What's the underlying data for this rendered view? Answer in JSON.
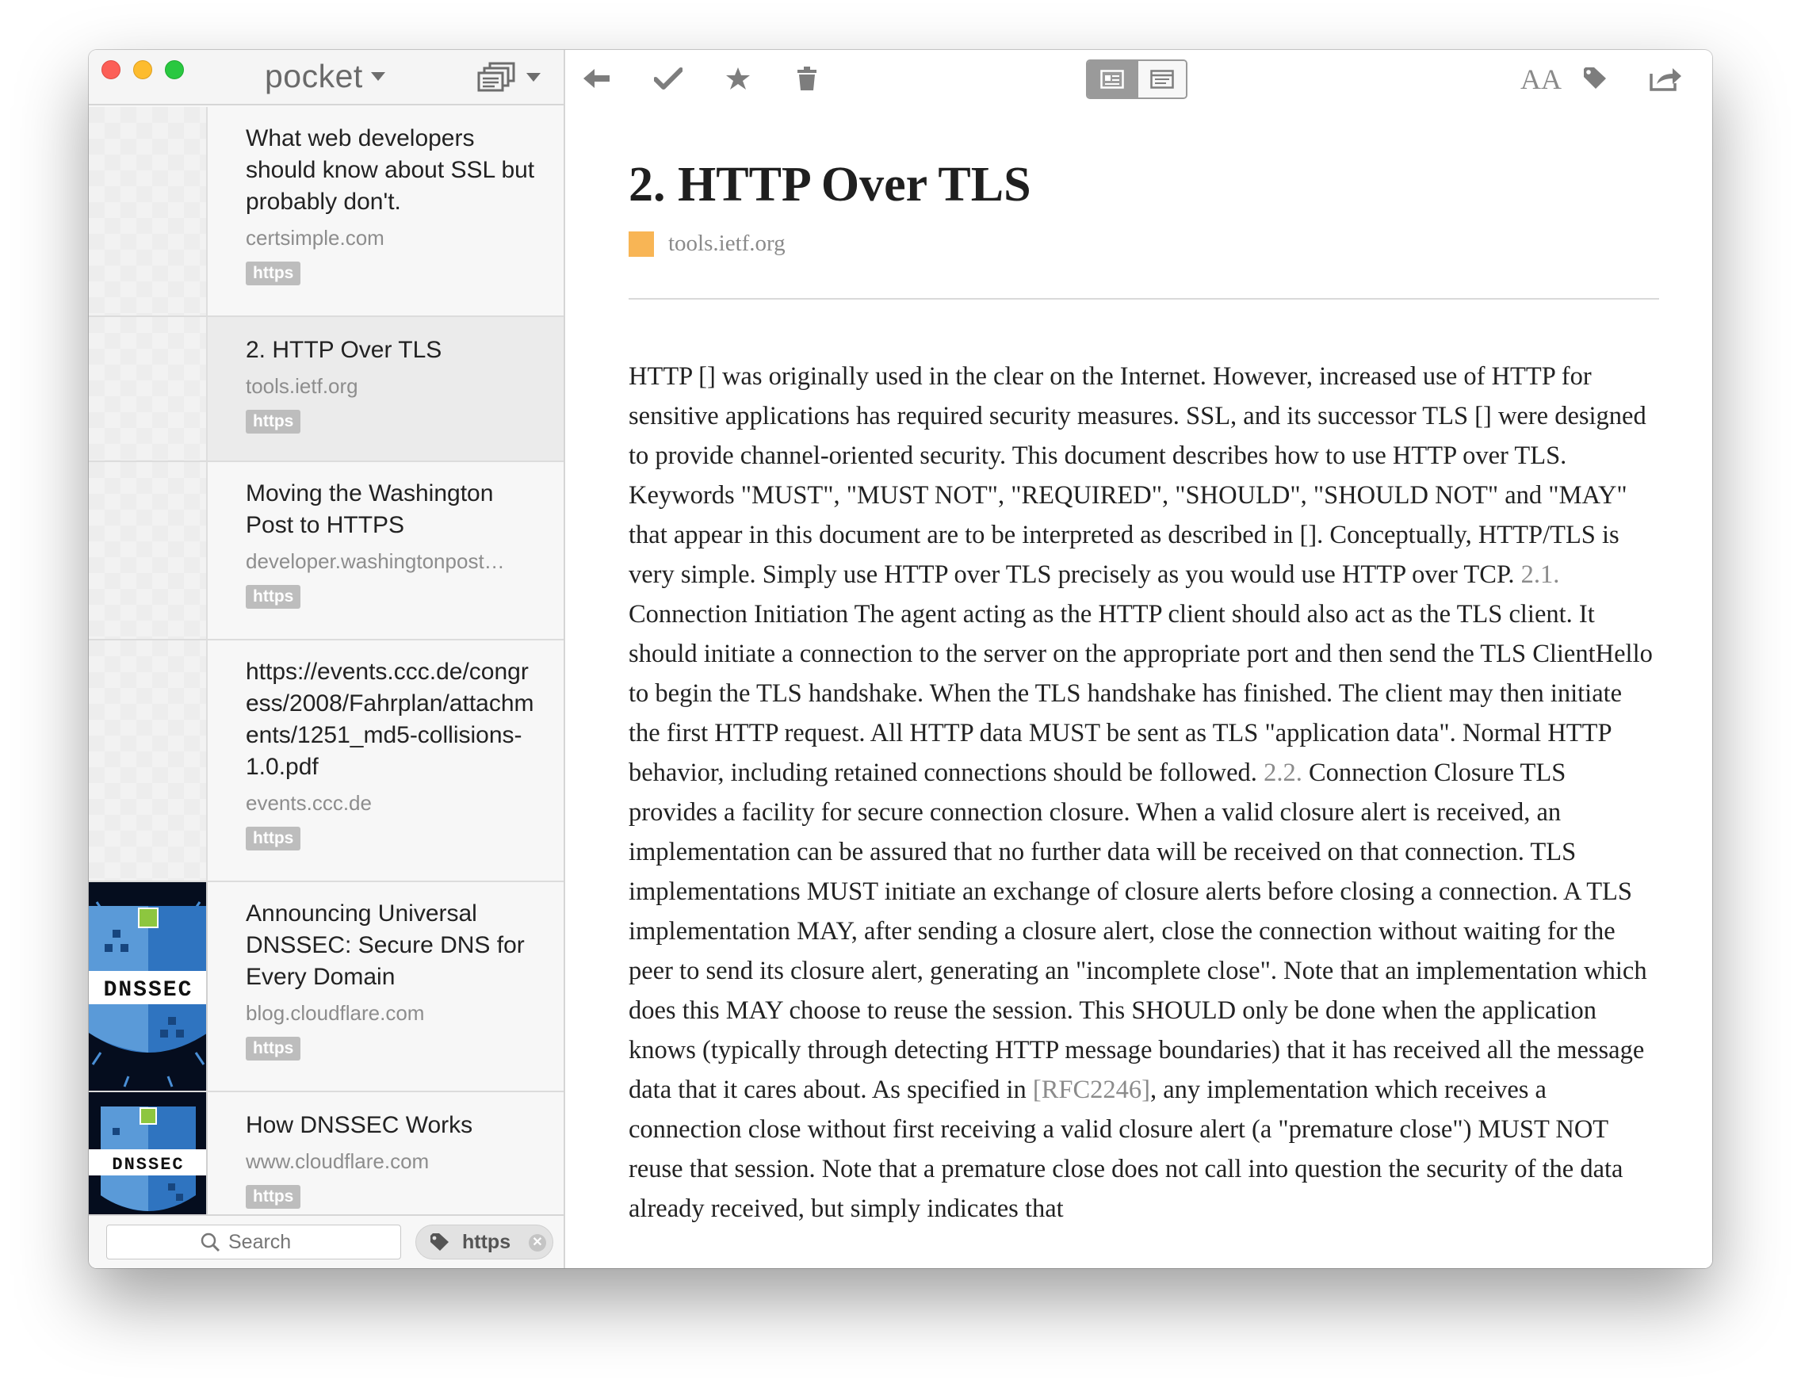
{
  "app": {
    "brand": "pocket"
  },
  "colors": {
    "accent_favicon": "#f8b555",
    "tag_badge": "#bdbdbd",
    "traffic_close": "#fc5f57",
    "traffic_min": "#fdbc2e",
    "traffic_max": "#29c840"
  },
  "list": {
    "items": [
      {
        "title": "What web developers should know about SSL but probably don't.",
        "source": "certsimple.com",
        "tag": "https",
        "thumbnail": "placeholder-pattern"
      },
      {
        "title": "2. HTTP Over TLS",
        "source": "tools.ietf.org",
        "tag": "https",
        "thumbnail": "placeholder-pattern",
        "selected": true
      },
      {
        "title": "Moving the Washington Post to HTTPS",
        "source": "developer.washingtonpost…",
        "tag": "https",
        "thumbnail": "placeholder-pattern"
      },
      {
        "title": "https://events.ccc.de/congress/2008/Fahrplan/attachments/1251_md5-collisions-1.0.pdf",
        "source": "events.ccc.de",
        "tag": "https",
        "thumbnail": "placeholder-pattern"
      },
      {
        "title": "Announcing Universal DNSSEC: Secure DNS for Every Domain",
        "source": "blog.cloudflare.com",
        "tag": "https",
        "thumbnail": "dnssec-shield",
        "thumb_text": "DNSSEC"
      },
      {
        "title": "How DNSSEC Works",
        "source": "www.cloudflare.com",
        "tag": "https",
        "thumbnail": "dnssec-shield",
        "thumb_text": "DNSSEC"
      }
    ]
  },
  "footer": {
    "search_placeholder": "Search",
    "active_tag": "https"
  },
  "toolbar": {
    "icons": [
      "back-arrow-icon",
      "checkmark-icon",
      "star-icon",
      "trash-icon",
      "article-view-icon",
      "web-view-icon",
      "font-settings-icon",
      "tag-icon",
      "share-icon"
    ],
    "font_label": "AA"
  },
  "article": {
    "title": "2. HTTP Over TLS",
    "source": "tools.ietf.org",
    "body": {
      "p1": "HTTP [] was originally used in the clear on the Internet. However, increased use of HTTP for sensitive applications has required security measures. SSL, and its successor TLS [] were designed to provide channel-oriented security. This document describes how to use HTTP over TLS. Keywords \"MUST\", \"MUST NOT\", \"REQUIRED\", \"SHOULD\", \"SHOULD NOT\" and \"MAY\" that appear in this document are to be interpreted as described in []. Conceptually, HTTP/TLS is very simple. Simply use HTTP over TLS precisely as you would use HTTP over TCP. ",
      "ref1": "2.1.",
      "p2": " Connection Initiation The agent acting as the HTTP client should also act as the TLS client. It should initiate a connection to the server on the appropriate port and then send the TLS ClientHello to begin the TLS handshake. When the TLS handshake has finished. The client may then initiate the first HTTP request. All HTTP data MUST be sent as TLS \"application data\". Normal HTTP behavior, including retained connections should be followed. ",
      "ref2": "2.2.",
      "p3": " Connection Closure TLS provides a facility for secure connection closure. When a valid closure alert is received, an implementation can be assured that no further data will be received on that connection. TLS implementations MUST initiate an exchange of closure alerts before closing a connection. A TLS implementation MAY, after sending a closure alert, close the connection without waiting for the peer to send its closure alert, generating an \"incomplete close\". Note that an implementation which does this MAY choose to reuse the session. This SHOULD only be done when the application knows (typically through detecting HTTP message boundaries) that it has received all the message data that it cares about. As specified in ",
      "link": "[RFC2246]",
      "p4": ", any implementation which receives a connection close without first receiving a valid closure alert (a \"premature close\") MUST NOT reuse that session. Note that a premature close does not call into question the security of the data already received, but simply indicates that"
    }
  }
}
